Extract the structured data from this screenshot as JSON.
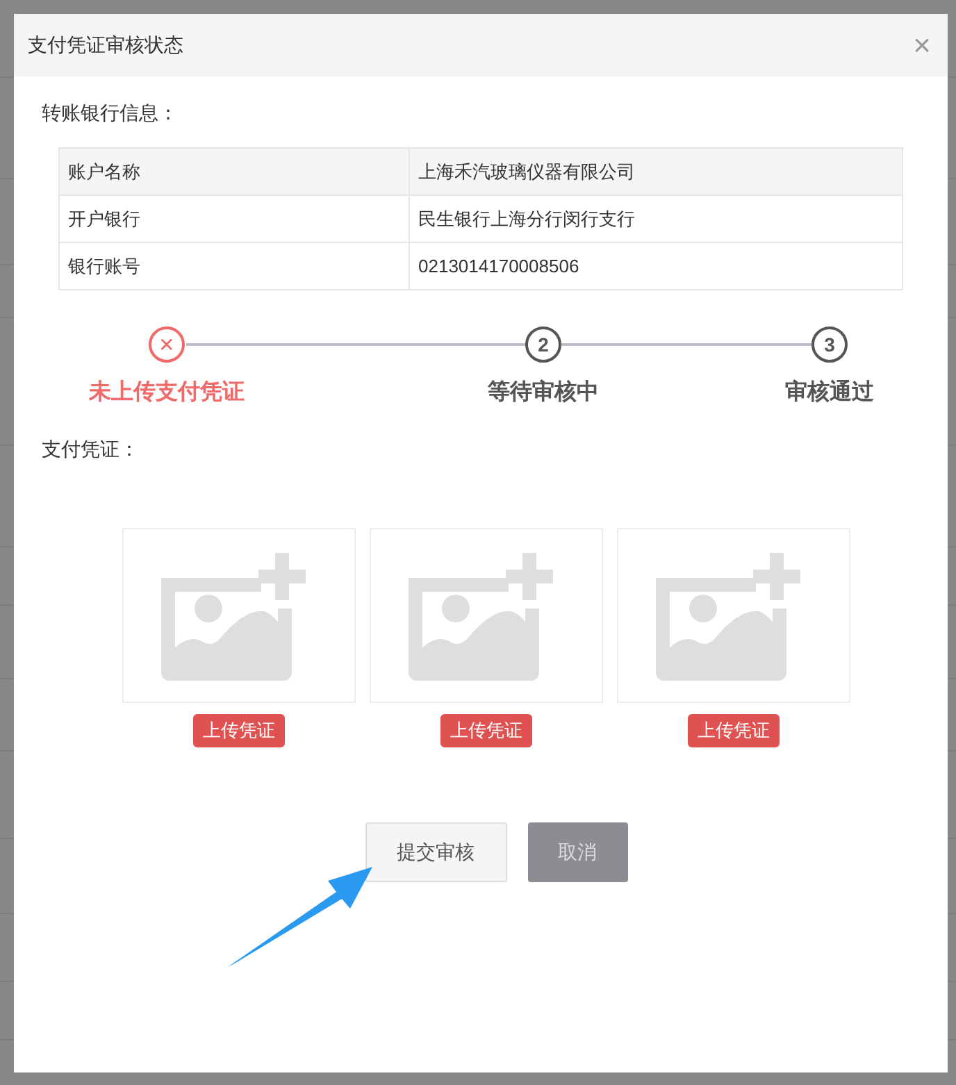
{
  "dialog": {
    "title": "支付凭证审核状态",
    "close": "×"
  },
  "bank_info": {
    "heading": "转账银行信息：",
    "rows": [
      {
        "label": "账户名称",
        "value": "上海禾汽玻璃仪器有限公司"
      },
      {
        "label": "开户银行",
        "value": "民生银行上海分行闵行支行"
      },
      {
        "label": "银行账号",
        "value": "0213014170008506"
      }
    ]
  },
  "steps": [
    {
      "kind": "error",
      "marker": "✕",
      "label": "未上传支付凭证"
    },
    {
      "kind": "wait",
      "marker": "2",
      "label": "等待审核中"
    },
    {
      "kind": "wait",
      "marker": "3",
      "label": "审核通过"
    }
  ],
  "voucher": {
    "heading": "支付凭证：",
    "slots": [
      {
        "button": "上传凭证"
      },
      {
        "button": "上传凭证"
      },
      {
        "button": "上传凭证"
      }
    ]
  },
  "buttons": [
    {
      "label": "提交审核",
      "disabled": false
    },
    {
      "label": "取消",
      "disabled": true
    }
  ]
}
